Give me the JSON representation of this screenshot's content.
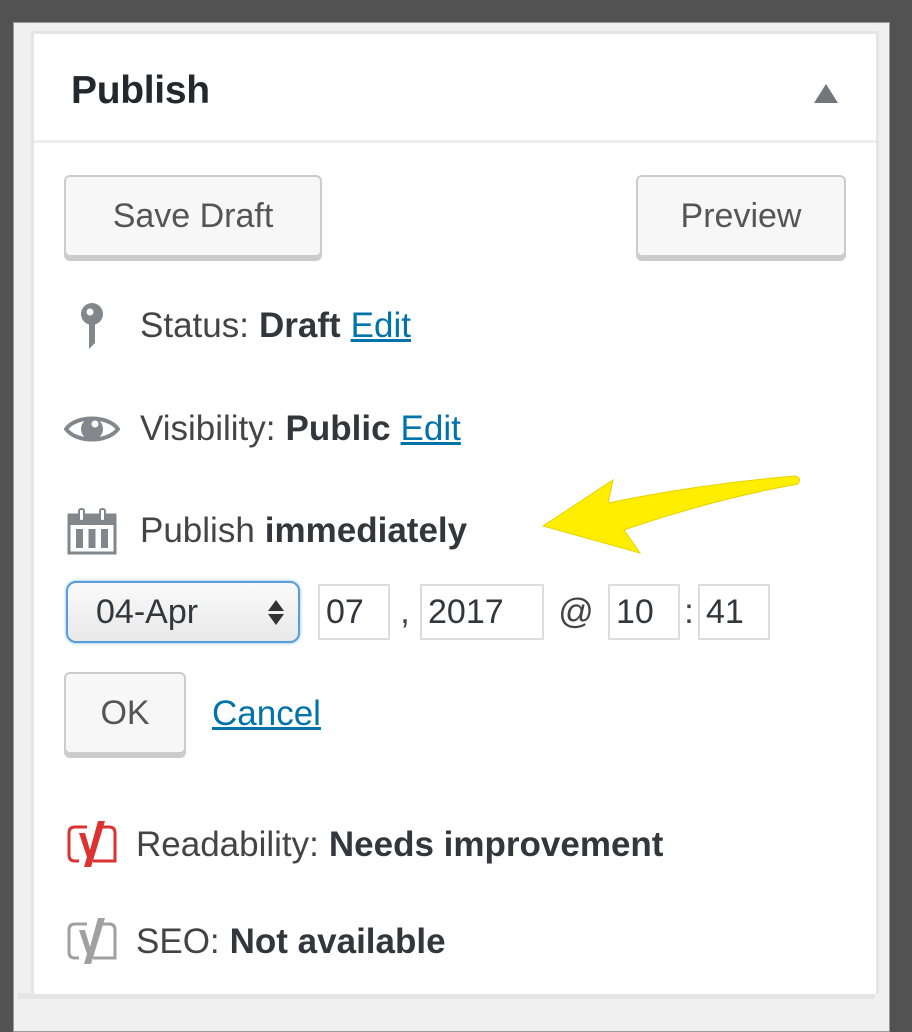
{
  "panel": {
    "title": "Publish",
    "toggle_icon": "triangle-up-icon"
  },
  "actions": {
    "save_draft_label": "Save Draft",
    "preview_label": "Preview"
  },
  "status": {
    "icon": "pin-icon",
    "label": "Status:",
    "value": "Draft",
    "edit_label": "Edit"
  },
  "visibility": {
    "icon": "eye-icon",
    "label": "Visibility:",
    "value": "Public",
    "edit_label": "Edit"
  },
  "schedule": {
    "icon": "calendar-icon",
    "label": "Publish",
    "value": "immediately"
  },
  "datetime": {
    "month_selected": "04-Apr",
    "day": "07",
    "comma": ",",
    "year": "2017",
    "at": "@",
    "hour": "10",
    "colon": ":",
    "minute": "41"
  },
  "confirm": {
    "ok_label": "OK",
    "cancel_label": "Cancel"
  },
  "readability": {
    "icon": "yoast-icon",
    "label": "Readability:",
    "value": "Needs improvement",
    "color": "#dc3232"
  },
  "seo": {
    "icon": "yoast-icon",
    "label": "SEO:",
    "value": "Not available",
    "color": "#a0a0a0"
  },
  "annotation": {
    "arrow_color": "#ffee00"
  },
  "colors": {
    "link": "#0073aa",
    "focus": "#5b9dd9",
    "icon_gray": "#82878c"
  }
}
